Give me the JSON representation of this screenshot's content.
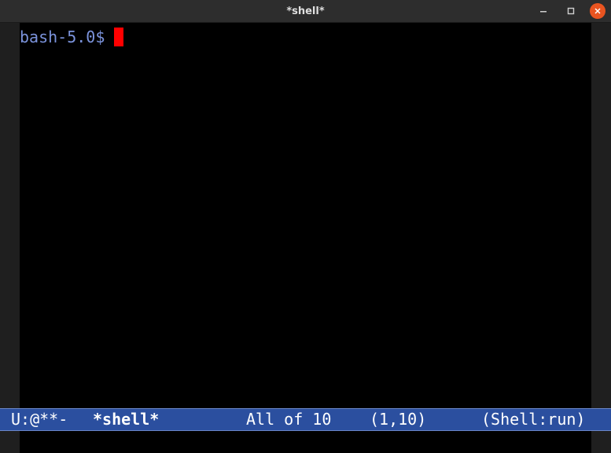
{
  "window": {
    "title": "*shell*"
  },
  "titlebar": {
    "buttons": [
      {
        "icon": "minimize-icon"
      },
      {
        "icon": "maximize-icon"
      },
      {
        "icon": "close-icon"
      }
    ],
    "close_color": "#e95420"
  },
  "buffer": {
    "prompt": "bash-5.0$",
    "prompt_color": "#7b93dc",
    "cursor_color": "#ff0000"
  },
  "modeline": {
    "status": "U:@**-",
    "buffer_name": "*shell*",
    "position": "All of 10",
    "line_col": "(1,10)",
    "mode": "(Shell:run)",
    "background_color": "#2b4f9f"
  },
  "echo_area": {
    "text": ""
  }
}
